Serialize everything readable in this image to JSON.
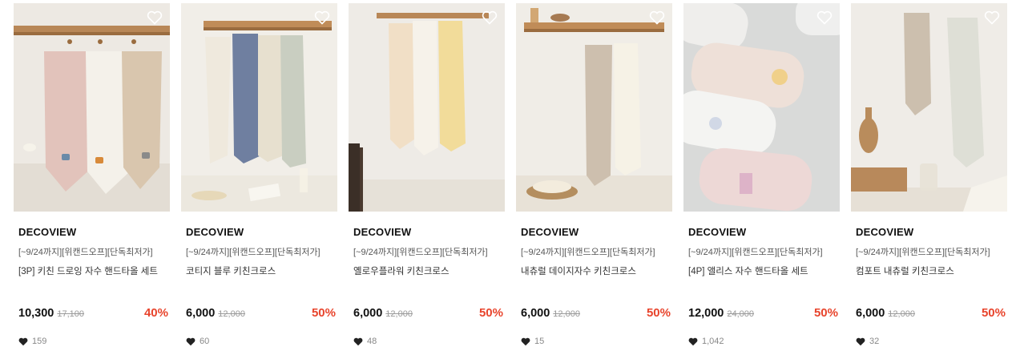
{
  "products": [
    {
      "brand": "DECOVIEW",
      "promo": "[~9/24까지][위캔드오프][단독최저가]",
      "name": "[3P] 키친 드로잉 자수 핸드타올 세트",
      "price": "10,300",
      "original_price": "17,100",
      "discount": "40%",
      "likes": "159",
      "image_icon": "towel-photo"
    },
    {
      "brand": "DECOVIEW",
      "promo": "[~9/24까지][위캔드오프][단독최저가]",
      "name": "코티지 블루 키친크로스",
      "price": "6,000",
      "original_price": "12,000",
      "discount": "50%",
      "likes": "60",
      "image_icon": "towel-photo"
    },
    {
      "brand": "DECOVIEW",
      "promo": "[~9/24까지][위캔드오프][단독최저가]",
      "name": "옐로우플라워 키친크로스",
      "price": "6,000",
      "original_price": "12,000",
      "discount": "50%",
      "likes": "48",
      "image_icon": "towel-photo"
    },
    {
      "brand": "DECOVIEW",
      "promo": "[~9/24까지][위캔드오프][단독최저가]",
      "name": "내츄럴 데이지자수 키친크로스",
      "price": "6,000",
      "original_price": "12,000",
      "discount": "50%",
      "likes": "15",
      "image_icon": "towel-photo"
    },
    {
      "brand": "DECOVIEW",
      "promo": "[~9/24까지][위캔드오프][단독최저가]",
      "name": "[4P] 앨리스 자수 핸드타올 세트",
      "price": "12,000",
      "original_price": "24,000",
      "discount": "50%",
      "likes": "1,042",
      "image_icon": "towel-photo"
    },
    {
      "brand": "DECOVIEW",
      "promo": "[~9/24까지][위캔드오프][단독최저가]",
      "name": "컴포트 내츄럴 키친크로스",
      "price": "6,000",
      "original_price": "12,000",
      "discount": "50%",
      "likes": "32",
      "image_icon": "towel-photo"
    }
  ],
  "colors": {
    "discount": "#e8442c",
    "shelf": "#b07a4a",
    "wall": "#ece8e1"
  },
  "icons": {
    "wishlist": "heart-outline-icon",
    "likes": "heart-filled-icon"
  }
}
